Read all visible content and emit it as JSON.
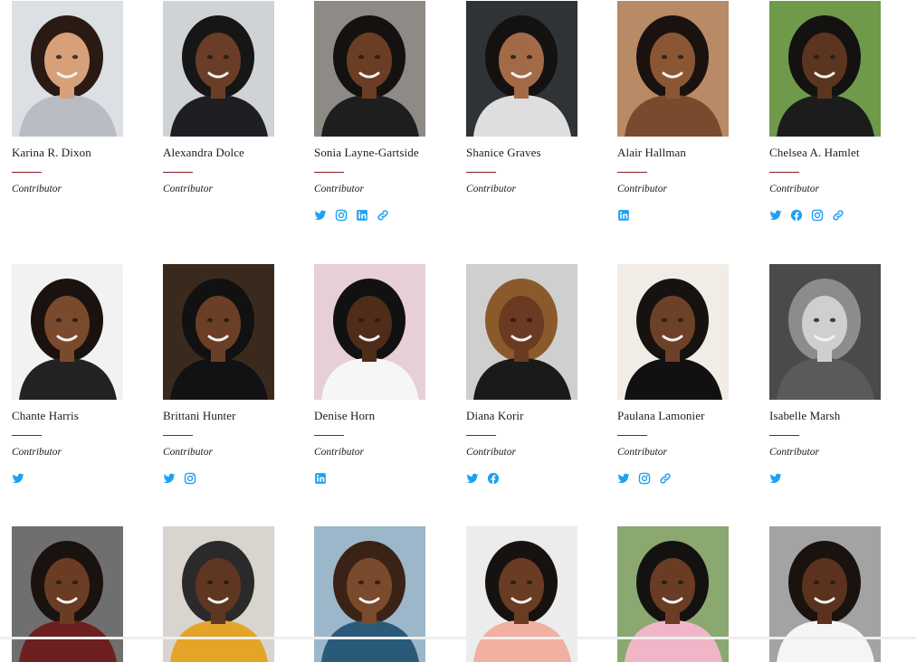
{
  "accent_color": "#1da1f2",
  "divider_color": "#8a1c2b",
  "contributors": [
    {
      "name": "Karina R. Dixon",
      "role": "Contributor",
      "socials": [],
      "photo_bg": "#dcdfe3",
      "skin": "#d7a079",
      "hair": "#2a1a14",
      "top": "#b9bcc2"
    },
    {
      "name": "Alexandra Dolce",
      "role": "Contributor",
      "socials": [],
      "photo_bg": "#cfd3d6",
      "skin": "#6a3d26",
      "hair": "#161616",
      "top": "#1f1f23"
    },
    {
      "name": "Sonia Layne-Gartside",
      "role": "Contributor",
      "socials": [
        "twitter-icon",
        "instagram-icon",
        "linkedin-icon",
        "link-icon"
      ],
      "photo_bg": "#8e8a86",
      "skin": "#6b3d25",
      "hair": "#141210",
      "top": "#1e1e1f"
    },
    {
      "name": "Shanice Graves",
      "role": "Contributor",
      "socials": [],
      "photo_bg": "#2f3336",
      "skin": "#a36a48",
      "hair": "#141210",
      "top": "#dedede"
    },
    {
      "name": "Alair Hallman",
      "role": "Contributor",
      "socials": [
        "linkedin-icon"
      ],
      "photo_bg": "#b88a66",
      "skin": "#8b5634",
      "hair": "#1a120e",
      "top": "#7a4a2e"
    },
    {
      "name": "Chelsea A. Hamlet",
      "role": "Contributor",
      "socials": [
        "twitter-icon",
        "facebook-icon",
        "instagram-icon",
        "link-icon"
      ],
      "photo_bg": "#6e9a4a",
      "skin": "#5c3520",
      "hair": "#141210",
      "top": "#1c1c1c"
    },
    {
      "name": "Chante Harris",
      "role": "Contributor",
      "socials": [
        "twitter-icon"
      ],
      "photo_bg": "#f2f2f2",
      "skin": "#7a4a2c",
      "hair": "#1a120e",
      "top": "#222222"
    },
    {
      "name": "Brittani Hunter",
      "role": "Contributor",
      "socials": [
        "twitter-icon",
        "instagram-icon"
      ],
      "photo_bg": "#3a2a1e",
      "skin": "#6b3f25",
      "hair": "#111111",
      "top": "#121214"
    },
    {
      "name": "Denise Horn",
      "role": "Contributor",
      "socials": [
        "linkedin-icon"
      ],
      "photo_bg": "#e7cfd6",
      "skin": "#4f2c1a",
      "hair": "#111111",
      "top": "#f6f6f6"
    },
    {
      "name": "Diana Korir",
      "role": "Contributor",
      "socials": [
        "twitter-icon",
        "facebook-icon"
      ],
      "photo_bg": "#cfcfcf",
      "skin": "#6a3b22",
      "hair": "#8a5a2a",
      "top": "#1a1a1a"
    },
    {
      "name": "Paulana Lamonier",
      "role": "Contributor",
      "socials": [
        "twitter-icon",
        "instagram-icon",
        "link-icon"
      ],
      "photo_bg": "#f1ede6",
      "skin": "#6d4128",
      "hair": "#161210",
      "top": "#111111"
    },
    {
      "name": "Isabelle Marsh",
      "role": "Contributor",
      "socials": [
        "twitter-icon"
      ],
      "photo_bg": "#4a4a4a",
      "skin": "#cfcfcf",
      "hair": "#8c8c8c",
      "top": "#5a5a5a"
    },
    {
      "name": "",
      "role": "",
      "socials": [],
      "photo_bg": "#6f6f6f",
      "skin": "#6a3c23",
      "hair": "#1a120e",
      "top": "#6e1f1f"
    },
    {
      "name": "",
      "role": "",
      "socials": [],
      "photo_bg": "#d9d4cd",
      "skin": "#5f3621",
      "hair": "#2a2a2a",
      "top": "#e3a428"
    },
    {
      "name": "",
      "role": "",
      "socials": [],
      "photo_bg": "#9cb7c9",
      "skin": "#7a4a2c",
      "hair": "#3a2316",
      "top": "#2a5a7a"
    },
    {
      "name": "",
      "role": "",
      "socials": [],
      "photo_bg": "#ececec",
      "skin": "#6a3c23",
      "hair": "#161210",
      "top": "#f1b0a0"
    },
    {
      "name": "",
      "role": "",
      "socials": [],
      "photo_bg": "#8aa870",
      "skin": "#6a3c23",
      "hair": "#141210",
      "top": "#f0b6c7"
    },
    {
      "name": "",
      "role": "",
      "socials": [],
      "photo_bg": "#a3a3a3",
      "skin": "#5a321d",
      "hair": "#1a120e",
      "top": "#f5f5f5"
    }
  ]
}
